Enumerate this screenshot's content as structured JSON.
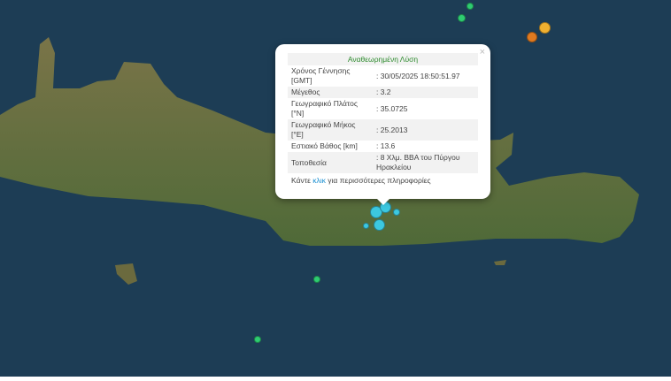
{
  "popup": {
    "title": "Αναθεωρημένη Λύση",
    "close": "×",
    "rows": [
      {
        "label": "Χρόνος Γέννησης [GMT]",
        "value": ": 30/05/2025 18:50:51.97"
      },
      {
        "label": "Μέγεθος",
        "value": ": 3.2"
      },
      {
        "label": "Γεωγραφικό Πλάτος [°N]",
        "value": ": 35.0725"
      },
      {
        "label": "Γεωγραφικό Μήκος [°E]",
        "value": ": 25.2013"
      },
      {
        "label": "Εστιακό Βάθος [km]",
        "value": ": 13.6"
      },
      {
        "label": "Τοποθεσία",
        "value": ": 8 Χλμ. ΒΒΑ του Πύργου Ηρακλείου"
      }
    ],
    "more_prefix": "Κάντε ",
    "more_link": "κλικ",
    "more_suffix": " για περισσότερες πληροφορίες"
  },
  "colors": {
    "sea": "#1d3d55",
    "land": "#6b6a3e",
    "recent": "#3cc8e0",
    "old": "#2ecc71",
    "orange": "#e07a20"
  }
}
